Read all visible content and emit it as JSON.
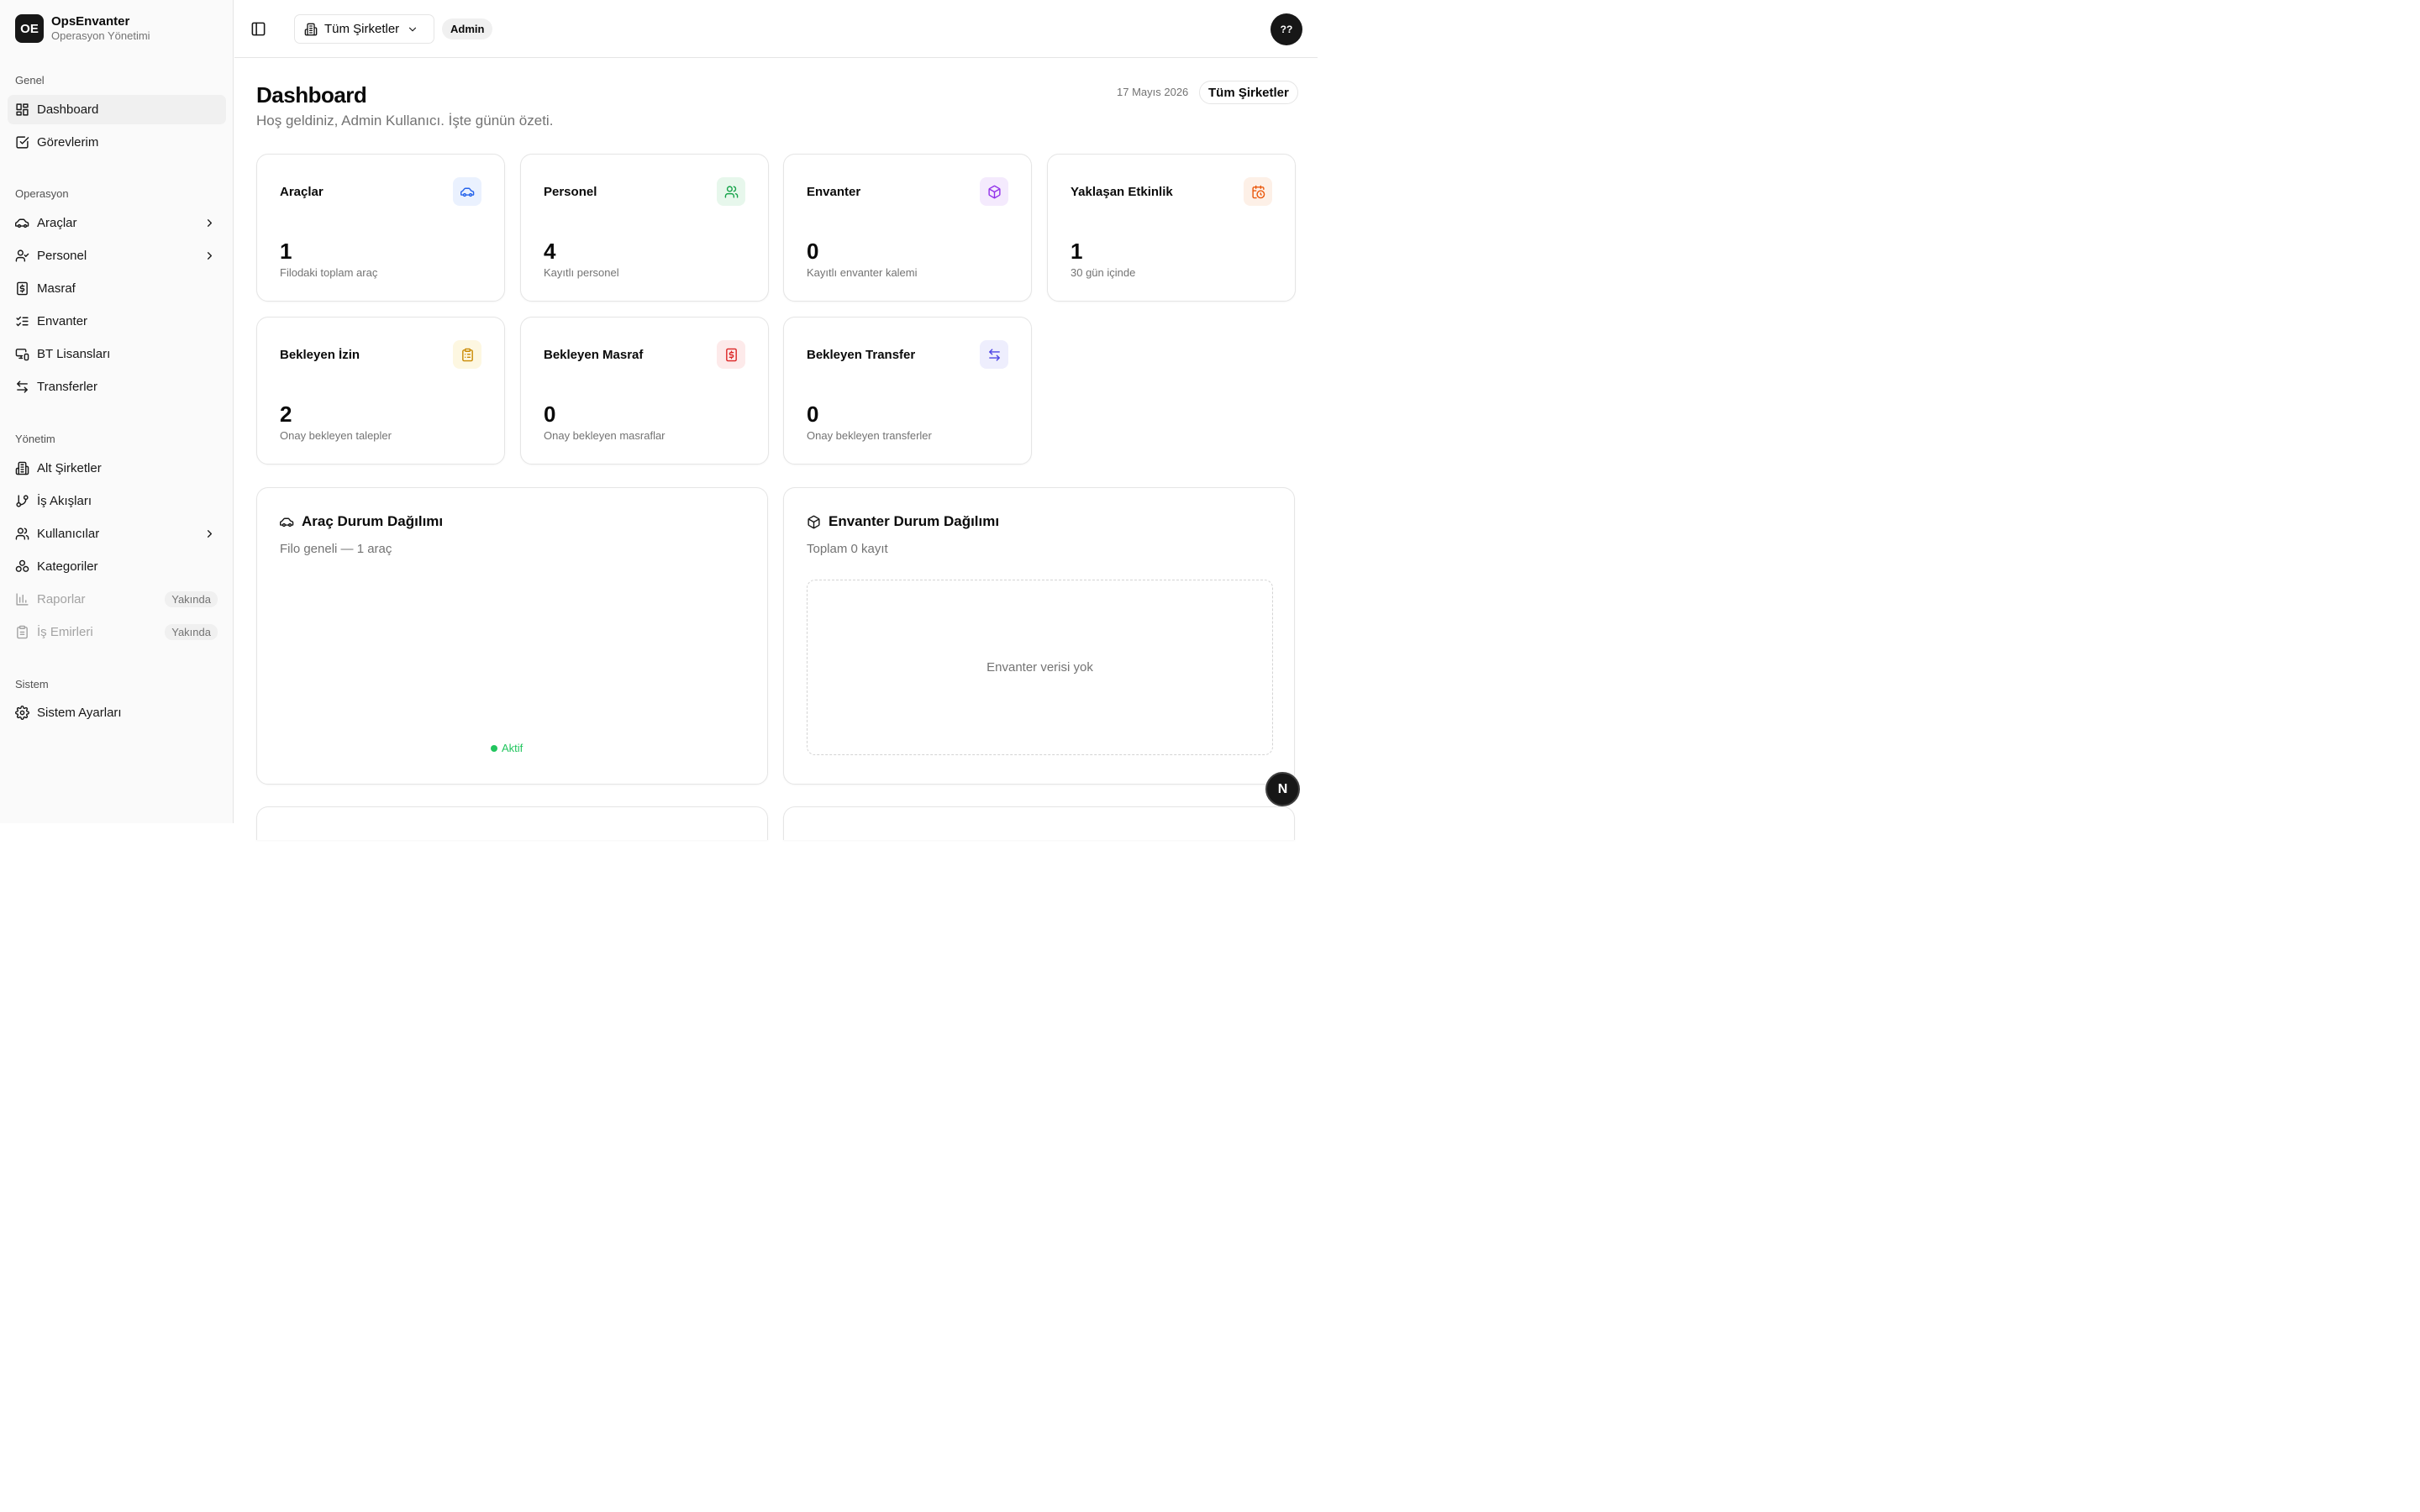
{
  "brand": {
    "logo": "OE",
    "title": "OpsEnvanter",
    "subtitle": "Operasyon Yönetimi"
  },
  "sidebar": {
    "groups": [
      {
        "label": "Genel",
        "items": [
          {
            "label": "Dashboard",
            "icon": "layout-dashboard-icon",
            "active": true
          },
          {
            "label": "Görevlerim",
            "icon": "square-check-icon"
          }
        ]
      },
      {
        "label": "Operasyon",
        "items": [
          {
            "label": "Araçlar",
            "icon": "car-icon",
            "chevron": true
          },
          {
            "label": "Personel",
            "icon": "user-check-icon",
            "chevron": true
          },
          {
            "label": "Masraf",
            "icon": "receipt-icon"
          },
          {
            "label": "Envanter",
            "icon": "list-checks-icon"
          },
          {
            "label": "BT Lisansları",
            "icon": "monitor-smartphone-icon"
          },
          {
            "label": "Transferler",
            "icon": "arrow-left-right-icon"
          }
        ]
      },
      {
        "label": "Yönetim",
        "items": [
          {
            "label": "Alt Şirketler",
            "icon": "building-icon"
          },
          {
            "label": "İş Akışları",
            "icon": "git-branch-icon"
          },
          {
            "label": "Kullanıcılar",
            "icon": "users-icon",
            "chevron": true
          },
          {
            "label": "Kategoriler",
            "icon": "shapes-icon"
          },
          {
            "label": "Raporlar",
            "icon": "bar-chart-icon",
            "badge": "Yakında",
            "disabled": true
          },
          {
            "label": "İş Emirleri",
            "icon": "clipboard-icon",
            "badge": "Yakında",
            "disabled": true
          }
        ]
      },
      {
        "label": "Sistem",
        "items": [
          {
            "label": "Sistem Ayarları",
            "icon": "gear-icon"
          }
        ]
      }
    ]
  },
  "topbar": {
    "company_select": "Tüm Şirketler",
    "role_badge": "Admin",
    "avatar": "??"
  },
  "header": {
    "title": "Dashboard",
    "subtitle": "Hoş geldiniz, Admin Kullanıcı. İşte günün özeti.",
    "date": "17 Mayıs 2026",
    "company_badge": "Tüm Şirketler"
  },
  "stats": [
    {
      "label": "Araçlar",
      "value": "1",
      "desc": "Filodaki toplam araç",
      "icon": "car-icon",
      "color": "#2563eb",
      "bg": "#eaf1fe"
    },
    {
      "label": "Personel",
      "value": "4",
      "desc": "Kayıtlı personel",
      "icon": "users-icon",
      "color": "#16a34a",
      "bg": "#e7f7ec"
    },
    {
      "label": "Envanter",
      "value": "0",
      "desc": "Kayıtlı envanter kalemi",
      "icon": "package-icon",
      "color": "#9333ea",
      "bg": "#f4eafd"
    },
    {
      "label": "Yaklaşan Etkinlik",
      "value": "1",
      "desc": "30 gün içinde",
      "icon": "calendar-clock-icon",
      "color": "#ea580c",
      "bg": "#fdf0e7"
    },
    {
      "label": "Bekleyen İzin",
      "value": "2",
      "desc": "Onay bekleyen talepler",
      "icon": "clipboard-list-icon",
      "color": "#ca8a04",
      "bg": "#fdf7e1"
    },
    {
      "label": "Bekleyen Masraf",
      "value": "0",
      "desc": "Onay bekleyen masraflar",
      "icon": "receipt-icon",
      "color": "#dc2626",
      "bg": "#fdeaea"
    },
    {
      "label": "Bekleyen Transfer",
      "value": "0",
      "desc": "Onay bekleyen transferler",
      "icon": "arrow-left-right-icon",
      "color": "#4f46e5",
      "bg": "#eeeefd"
    }
  ],
  "vehicle_chart": {
    "title": "Araç Durum Dağılımı",
    "subtitle": "Filo geneli — 1 araç",
    "legend": [
      {
        "name": "Aktif",
        "color": "#22c55e"
      }
    ]
  },
  "inventory_chart": {
    "title": "Envanter Durum Dağılımı",
    "subtitle": "Toplam 0 kayıt",
    "empty_text": "Envanter verisi yok"
  },
  "dev_button": "N"
}
